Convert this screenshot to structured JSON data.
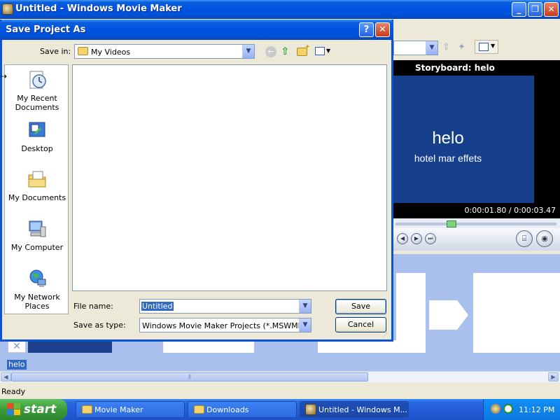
{
  "main_window": {
    "title": "Untitled - Windows Movie Maker",
    "controls": {
      "minimize": "_",
      "maximize": "❐",
      "close": "✕"
    }
  },
  "dialog": {
    "title": "Save Project As",
    "help_button": "?",
    "close_button": "✕",
    "save_in_label": "Save in:",
    "save_in_value": "My Videos",
    "places": [
      {
        "label": "My Recent Documents",
        "icon": "recent-documents-icon"
      },
      {
        "label": "Desktop",
        "icon": "desktop-icon"
      },
      {
        "label": "My Documents",
        "icon": "my-documents-icon"
      },
      {
        "label": "My Computer",
        "icon": "my-computer-icon"
      },
      {
        "label": "My Network Places",
        "icon": "network-places-icon"
      }
    ],
    "file_name_label": "File name:",
    "file_name_value": "Untitled",
    "save_as_type_label": "Save as type:",
    "save_as_type_value": "Windows Movie Maker Projects (*.MSWMM)",
    "save_button": "Save",
    "cancel_button": "Cancel"
  },
  "preview": {
    "storyboard_header": "Storyboard: helo",
    "title_text": "helo",
    "subtitle_text": "hotel mar effets",
    "time_display": "0:00:01.80 / 0:00:03.47"
  },
  "storyboard": {
    "clip_label": "helo"
  },
  "statusbar": {
    "text": "Ready"
  },
  "taskbar": {
    "start_label": "start",
    "buttons": [
      {
        "label": "Movie Maker",
        "icon": "folder-icon"
      },
      {
        "label": "Downloads",
        "icon": "folder-icon"
      },
      {
        "label": "Untitled - Windows M...",
        "icon": "movie-maker-icon"
      }
    ],
    "clock": "11:12 PM"
  },
  "colors": {
    "title_bar": "#0054e3",
    "preview_background": "#16408c",
    "storyboard_background": "#a9c0ee",
    "start_button": "#3a9b3a"
  }
}
